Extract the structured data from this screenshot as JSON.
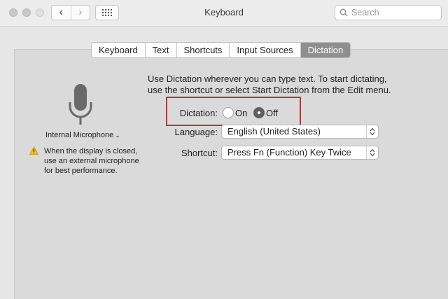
{
  "window": {
    "title": "Keyboard"
  },
  "toolbar": {
    "back_icon": "‹",
    "forward_icon": "›",
    "search_placeholder": "Search"
  },
  "tabs": [
    {
      "label": "Keyboard"
    },
    {
      "label": "Text"
    },
    {
      "label": "Shortcuts"
    },
    {
      "label": "Input Sources"
    },
    {
      "label": "Dictation"
    }
  ],
  "microphone": {
    "selected": "Internal Microphone",
    "warning": [
      "When the display is closed,",
      "use an external microphone",
      "for best performance."
    ]
  },
  "description": [
    "Use Dictation wherever you can type text. To start dictating,",
    "use the shortcut or select Start Dictation from the Edit menu."
  ],
  "dictation": {
    "label": "Dictation:",
    "on_label": "On",
    "off_label": "Off",
    "selected": "Off"
  },
  "language": {
    "label": "Language:",
    "value": "English (United States)"
  },
  "shortcut": {
    "label": "Shortcut:",
    "value": "Press Fn (Function) Key Twice"
  },
  "colors": {
    "highlight_box": "#c9302c",
    "active_tab": "#8f8f8f"
  }
}
